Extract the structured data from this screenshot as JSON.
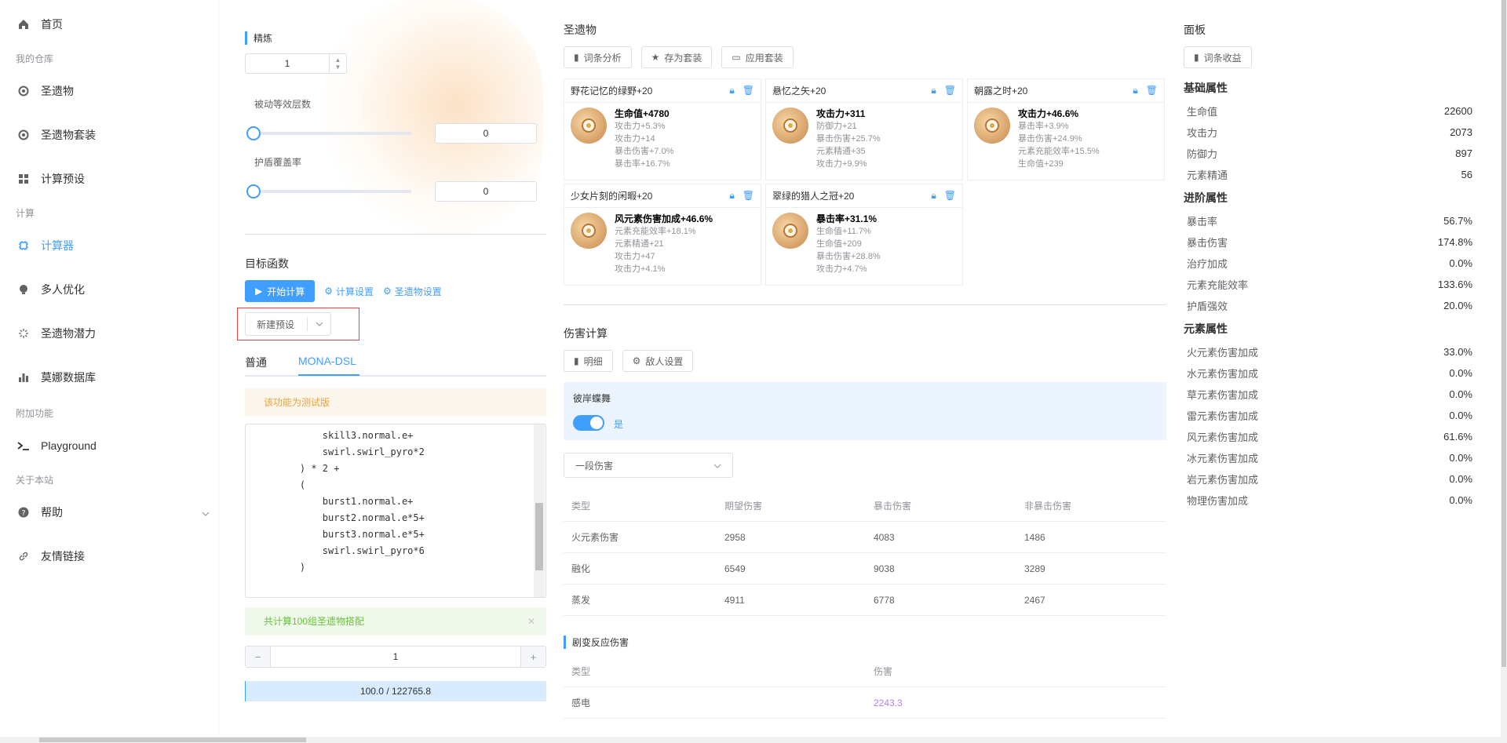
{
  "sidebar": {
    "items": [
      {
        "label": "首页",
        "icon": "home-icon"
      },
      {
        "label": "我的仓库"
      },
      {
        "label": "圣遗物",
        "icon": "artifact-icon"
      },
      {
        "label": "圣遗物套装",
        "icon": "artifact-set-icon"
      },
      {
        "label": "计算预设",
        "icon": "grid-icon"
      },
      {
        "label": "计算"
      },
      {
        "label": "计算器",
        "icon": "chip-icon"
      },
      {
        "label": "多人优化",
        "icon": "bulb-icon"
      },
      {
        "label": "圣遗物潜力",
        "icon": "spinner-icon"
      },
      {
        "label": "莫娜数据库",
        "icon": "bar-chart-icon"
      },
      {
        "label": "附加功能"
      },
      {
        "label": "Playground",
        "icon": "terminal-icon"
      },
      {
        "label": "关于本站"
      },
      {
        "label": "帮助",
        "icon": "help-icon"
      },
      {
        "label": "友情链接",
        "icon": "link-icon"
      }
    ]
  },
  "left": {
    "refine_label": "精炼",
    "refine_value": "1",
    "passive_label": "被动等效层数",
    "passive_value": "0",
    "shield_label": "护盾覆盖率",
    "shield_value": "0",
    "target_title": "目标函数",
    "start_btn": "开始计算",
    "calc_settings": "计算设置",
    "artifact_settings": "圣遗物设置",
    "preset_select": "新建预设",
    "tab_normal": "普通",
    "tab_dsl": "MONA-DSL",
    "warning": "该功能为测试版",
    "code_lines": [
      "        skill3.normal.e+",
      "        swirl.swirl_pyro*2",
      "    ) * 2 +",
      "    (",
      "        burst1.normal.e+",
      "        burst2.normal.e*5+",
      "        burst3.normal.e*5+",
      "        swirl.swirl_pyro*6",
      "    )"
    ],
    "success": "共计算100组圣遗物搭配",
    "page_value": "1",
    "progress_text": "100.0 / 122765.8",
    "progress": 0.0008
  },
  "artifacts": {
    "title": "圣遗物",
    "btn_analysis": "词条分析",
    "btn_save": "存为套装",
    "btn_apply": "应用套装",
    "cards": [
      {
        "name": "野花记忆的绿野+20",
        "main": "生命值+4780",
        "subs": [
          "攻击力+5.3%",
          "攻击力+14",
          "暴击伤害+7.0%",
          "暴击率+16.7%"
        ],
        "icon": "flower-icon"
      },
      {
        "name": "悬忆之矢+20",
        "main": "攻击力+311",
        "subs": [
          "防御力+21",
          "暴击伤害+25.7%",
          "元素精通+35",
          "攻击力+9.9%"
        ],
        "icon": "feather-icon"
      },
      {
        "name": "朝露之时+20",
        "main": "攻击力+46.6%",
        "subs": [
          "暴击率+3.9%",
          "暴击伤害+24.9%",
          "元素充能效率+15.5%",
          "生命值+239"
        ],
        "icon": "sands-icon"
      },
      {
        "name": "少女片刻的闲暇+20",
        "main": "风元素伤害加成+46.6%",
        "subs": [
          "元素充能效率+18.1%",
          "元素精通+21",
          "攻击力+47",
          "攻击力+4.1%"
        ],
        "icon": "goblet-icon"
      },
      {
        "name": "翠绿的猎人之冠+20",
        "main": "暴击率+31.1%",
        "subs": [
          "生命值+11.7%",
          "生命值+209",
          "暴击伤害+28.8%",
          "攻击力+4.7%"
        ],
        "icon": "circlet-icon"
      }
    ]
  },
  "damage": {
    "title": "伤害计算",
    "btn_detail": "明细",
    "btn_enemy": "敌人设置",
    "option_title": "彼岸蝶舞",
    "toggle_label": "是",
    "select_value": "一段伤害",
    "headers": [
      "类型",
      "期望伤害",
      "暴击伤害",
      "非暴击伤害"
    ],
    "rows": [
      [
        "火元素伤害",
        "2958",
        "4083",
        "1486"
      ],
      [
        "融化",
        "6549",
        "9038",
        "3289"
      ],
      [
        "蒸发",
        "4911",
        "6778",
        "2467"
      ]
    ],
    "transform_title": "剧变反应伤害",
    "t_headers": [
      "类型",
      "伤害"
    ],
    "t_rows": [
      [
        "感电",
        "2243.3"
      ]
    ],
    "t_color": "#b37feb"
  },
  "panel": {
    "title": "面板",
    "btn": "词条收益",
    "basic_title": "基础属性",
    "basic": [
      [
        "生命值",
        "22600"
      ],
      [
        "攻击力",
        "2073"
      ],
      [
        "防御力",
        "897"
      ],
      [
        "元素精通",
        "56"
      ]
    ],
    "adv_title": "进阶属性",
    "adv": [
      [
        "暴击率",
        "56.7%"
      ],
      [
        "暴击伤害",
        "174.8%"
      ],
      [
        "治疗加成",
        "0.0%"
      ],
      [
        "元素充能效率",
        "133.6%"
      ],
      [
        "护盾强效",
        "20.0%"
      ]
    ],
    "elem_title": "元素属性",
    "elem": [
      [
        "火元素伤害加成",
        "33.0%"
      ],
      [
        "水元素伤害加成",
        "0.0%"
      ],
      [
        "草元素伤害加成",
        "0.0%"
      ],
      [
        "雷元素伤害加成",
        "0.0%"
      ],
      [
        "风元素伤害加成",
        "61.6%"
      ],
      [
        "冰元素伤害加成",
        "0.0%"
      ],
      [
        "岩元素伤害加成",
        "0.0%"
      ],
      [
        "物理伤害加成",
        "0.0%"
      ]
    ]
  },
  "colors": {
    "accent": "#409eff",
    "highlight_border": "#e84646"
  }
}
